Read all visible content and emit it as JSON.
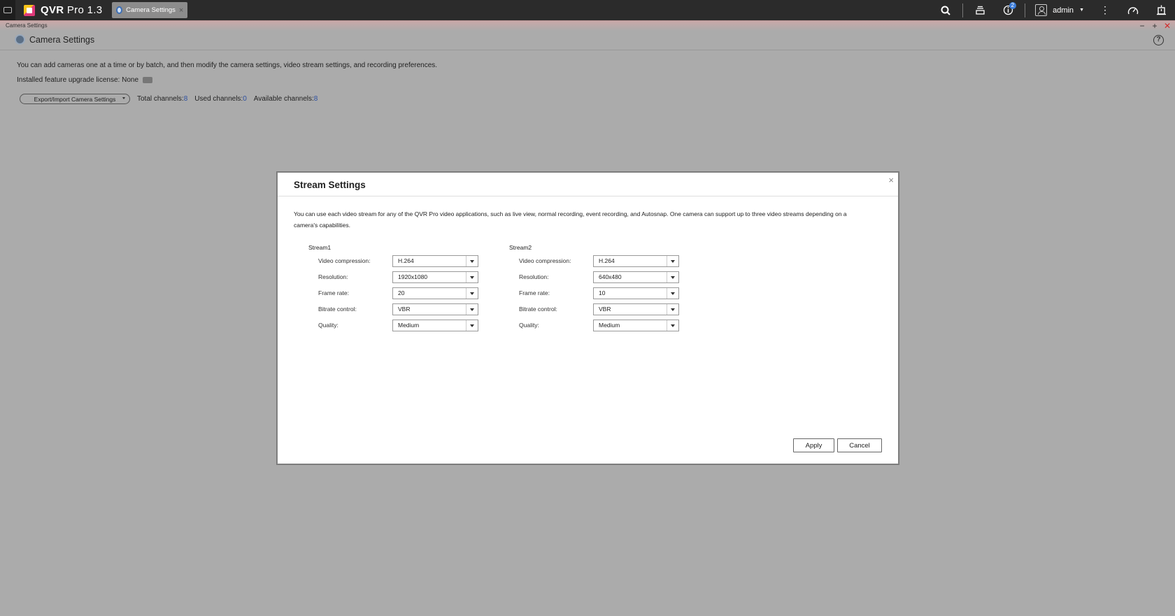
{
  "topbar": {
    "app_name": "QVR",
    "app_version": "Pro 1.3",
    "tab_label": "Camera Settings",
    "tab_close": "×",
    "notification_count": "2",
    "user": "admin",
    "icons": [
      "menu-icon",
      "search-icon",
      "tasks-icon",
      "info-icon",
      "user-icon",
      "more-icon",
      "dashboard-icon",
      "alarm-icon"
    ]
  },
  "window": {
    "titlebar_label": "Camera Settings",
    "controls": {
      "minimize": "−",
      "maximize": "+",
      "close": "✕"
    },
    "header_title": "Camera Settings",
    "help": "?"
  },
  "page": {
    "intro": "You can add cameras one at a time or by batch, and then modify the camera settings, video stream settings, and recording preferences.",
    "license_label": "Installed feature upgrade license: None",
    "export_button": "Export/Import Camera Settings",
    "total_label": "Total channels:",
    "total_value": "8",
    "used_label": "Used channels:",
    "used_value": "0",
    "available_label": "Available channels:",
    "available_value": "8"
  },
  "modal": {
    "title": "Stream Settings",
    "close": "×",
    "description": "You can use each video stream for any of the QVR Pro video applications, such as live view, normal recording, event recording, and Autosnap. One camera can support up to three video streams depending on a camera's capabilities.",
    "field_labels": {
      "compression": "Video compression:",
      "resolution": "Resolution:",
      "framerate": "Frame rate:",
      "bitrate": "Bitrate control:",
      "quality": "Quality:"
    },
    "stream1": {
      "title": "Stream1",
      "compression": "H.264",
      "resolution": "1920x1080",
      "framerate": "20",
      "bitrate": "VBR",
      "quality": "Medium"
    },
    "stream2": {
      "title": "Stream2",
      "compression": "H.264",
      "resolution": "640x480",
      "framerate": "10",
      "bitrate": "VBR",
      "quality": "Medium"
    },
    "apply": "Apply",
    "cancel": "Cancel"
  }
}
